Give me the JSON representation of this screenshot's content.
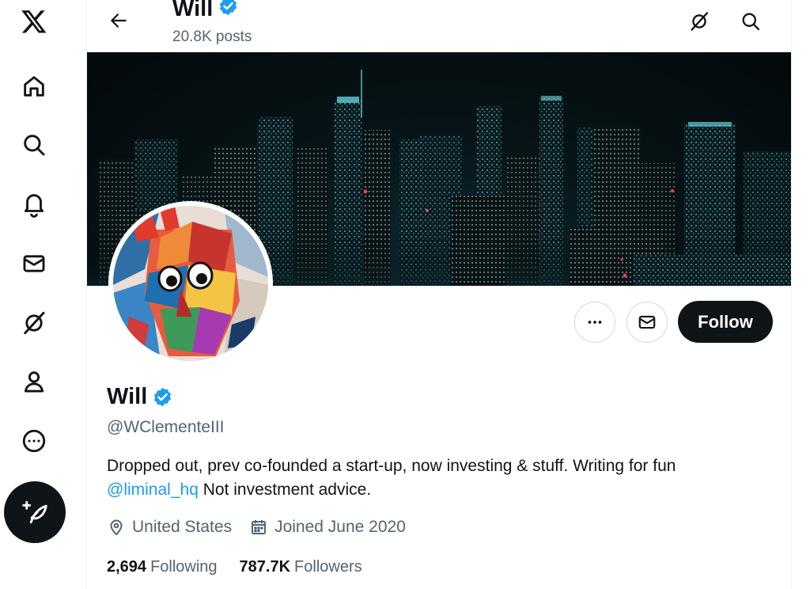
{
  "nav": {
    "items": [
      {
        "icon": "x-logo-icon",
        "label": "X"
      },
      {
        "icon": "home-icon",
        "label": "Home"
      },
      {
        "icon": "search-icon",
        "label": "Explore"
      },
      {
        "icon": "bell-icon",
        "label": "Notifications"
      },
      {
        "icon": "mail-icon",
        "label": "Messages"
      },
      {
        "icon": "grok-icon",
        "label": "Grok"
      },
      {
        "icon": "person-icon",
        "label": "Profile"
      },
      {
        "icon": "more-circle-icon",
        "label": "More"
      }
    ],
    "post_button_icon": "feather-plus-icon"
  },
  "header": {
    "name": "Will",
    "posts_count": "20.8K posts"
  },
  "profile": {
    "name": "Will",
    "handle": "@WClementeIII",
    "bio_text": "Dropped out, prev co-founded a start-up, now investing & stuff. Writing for fun",
    "bio_mention": "@liminal_hq",
    "bio_tail": "Not investment advice.",
    "location": "United States",
    "joined": "Joined June 2020",
    "following_count": "2,694",
    "following_label": "Following",
    "followers_count": "787.7K",
    "followers_label": "Followers",
    "follow_button": "Follow"
  },
  "colors": {
    "accent": "#1d9bf0",
    "text": "#0f1419",
    "secondary": "#536471",
    "button_dark": "#0f1419"
  }
}
